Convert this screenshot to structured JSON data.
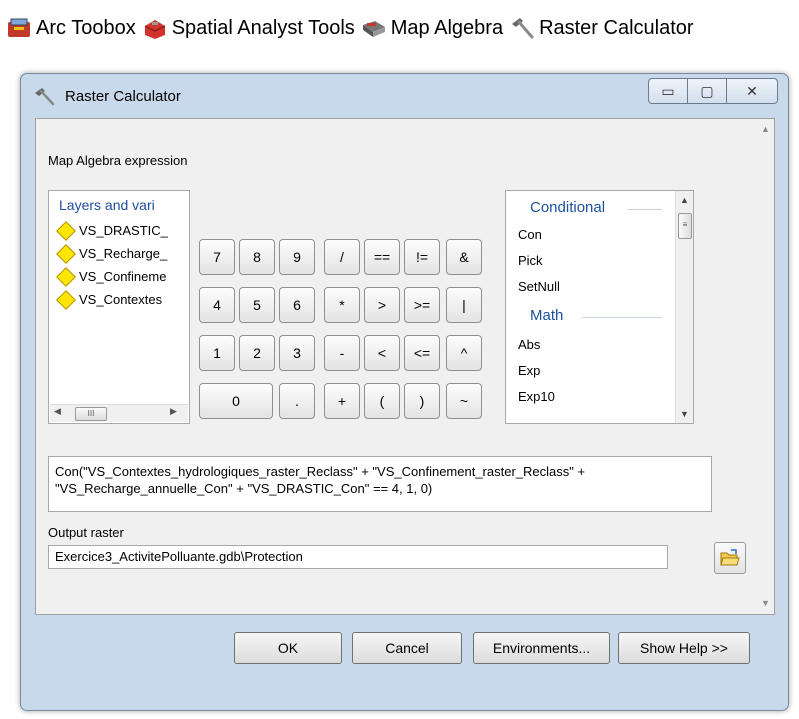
{
  "breadcrumb": {
    "items": [
      {
        "label": "Arc Toobox",
        "icon": "toolbox-icon"
      },
      {
        "label": "Spatial Analyst Tools",
        "icon": "toolbox-red-icon"
      },
      {
        "label": "Map Algebra",
        "icon": "toolset-icon"
      },
      {
        "label": "Raster Calculator",
        "icon": "hammer-icon"
      }
    ]
  },
  "window": {
    "title": "Raster Calculator",
    "buttons": {
      "minimize": "▭",
      "maximize": "▢",
      "close": "✕"
    }
  },
  "expression": {
    "label": "Map Algebra expression",
    "layers_header": "Layers and vari",
    "layers": [
      "VS_DRASTIC_",
      "VS_Recharge_",
      "VS_Confineme",
      "VS_Contextes"
    ],
    "keys": {
      "row1": [
        "7",
        "8",
        "9",
        "/",
        "==",
        "!=",
        "&"
      ],
      "row2": [
        "4",
        "5",
        "6",
        "*",
        ">",
        ">=",
        "|"
      ],
      "row3": [
        "1",
        "2",
        "3",
        "-",
        "<",
        "<=",
        "^"
      ],
      "row4": [
        "0",
        ".",
        "+",
        "(",
        ")",
        "~"
      ]
    },
    "functions": {
      "conditional_header": "Conditional",
      "conditional": [
        "Con",
        "Pick",
        "SetNull"
      ],
      "math_header": "Math",
      "math": [
        "Abs",
        "Exp",
        "Exp10"
      ]
    },
    "text": "Con(\"VS_Contextes_hydrologiques_raster_Reclass\" + \"VS_Confinement_raster_Reclass\" + \"VS_Recharge_annuelle_Con\" + \"VS_DRASTIC_Con\" == 4, 1, 0)"
  },
  "output": {
    "label": "Output raster",
    "value": "Exercice3_ActivitePolluante.gdb\\Protection"
  },
  "footer": {
    "ok": "OK",
    "cancel": "Cancel",
    "environments": "Environments...",
    "show_help": "Show Help >>"
  },
  "colors": {
    "window_frame": "#c9d9ec",
    "header_blue": "#1d4f9e",
    "layer_diamond": "#ffe600"
  }
}
